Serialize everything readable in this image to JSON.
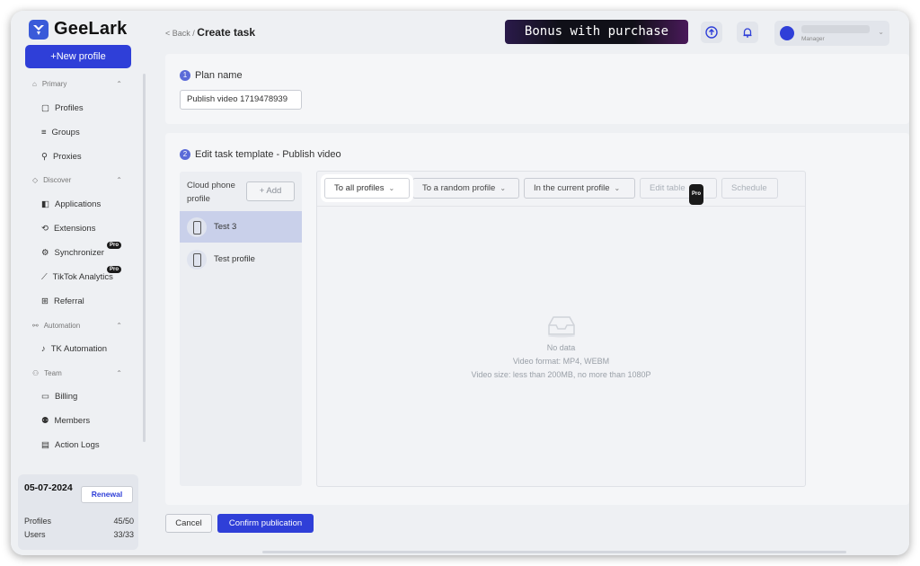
{
  "app": {
    "name": "GeeLark"
  },
  "sidebar": {
    "new_profile_label": "+New profile",
    "sections": [
      {
        "label": "Primary"
      },
      {
        "label": "Discover"
      },
      {
        "label": "Automation"
      },
      {
        "label": "Team"
      }
    ],
    "items": [
      {
        "label": "Profiles",
        "icon": "profiles-icon"
      },
      {
        "label": "Groups",
        "icon": "groups-icon"
      },
      {
        "label": "Proxies",
        "icon": "proxies-icon"
      },
      {
        "label": "Applications",
        "icon": "applications-icon"
      },
      {
        "label": "Extensions",
        "icon": "extensions-icon"
      },
      {
        "label": "Synchronizer",
        "icon": "synchronizer-icon",
        "badge": "Pro"
      },
      {
        "label": "TikTok Analytics",
        "icon": "analytics-icon",
        "badge": "Pro"
      },
      {
        "label": "Referral",
        "icon": "gift-icon"
      },
      {
        "label": "TK Automation",
        "icon": "tiktok-icon"
      },
      {
        "label": "Billing",
        "icon": "billing-icon"
      },
      {
        "label": "Members",
        "icon": "members-icon"
      },
      {
        "label": "Action Logs",
        "icon": "logs-icon"
      }
    ],
    "plan": {
      "date": "05-07-2024",
      "renewal_label": "Renewal",
      "profiles_label": "Profiles",
      "profiles_value": "45/50",
      "users_label": "Users",
      "users_value": "33/33"
    }
  },
  "header": {
    "back_label": "< Back /",
    "title": "Create task",
    "bonus_text": "Bonus with purchase",
    "user_role": "Manager"
  },
  "plan_name": {
    "step": "1",
    "title": "Plan name",
    "value": "Publish video 1719478939"
  },
  "template": {
    "step": "2",
    "title": "Edit task template - Publish video",
    "cloud_phone_label": "Cloud phone profile",
    "add_label": "+ Add",
    "profiles": [
      {
        "name": "Test 3",
        "selected": true
      },
      {
        "name": "Test profile",
        "selected": false
      }
    ],
    "filters": [
      {
        "label": "To all profiles"
      },
      {
        "label": "To a random profile"
      },
      {
        "label": "In the current profile"
      }
    ],
    "edit_table_label": "Edit table",
    "edit_table_badge": "Pro",
    "schedule_label": "Schedule",
    "empty": {
      "title": "No data",
      "format": "Video format: MP4, WEBM",
      "size": "Video size: less than 200MB, no more than 1080P"
    }
  },
  "footer": {
    "cancel_label": "Cancel",
    "confirm_label": "Confirm publication"
  },
  "colors": {
    "accent": "#2f3fd8",
    "selected_row": "#c9d0ea",
    "overlay_bg": "#eef0f3"
  }
}
